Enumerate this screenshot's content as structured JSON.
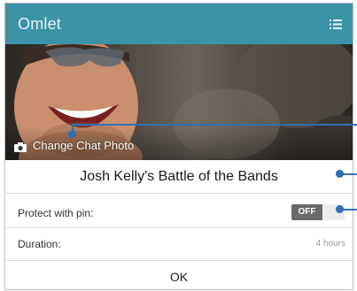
{
  "app": {
    "title": "Omlet"
  },
  "header": {
    "menu_icon": "list-menu-icon"
  },
  "photo": {
    "change_label": "Change Chat Photo",
    "camera_icon": "camera-icon"
  },
  "chat": {
    "title": "Josh Kelly's Battle of the Bands"
  },
  "settings": {
    "protect_label": "Protect with pin:",
    "protect_state": "OFF",
    "duration_label": "Duration:",
    "duration_value": "4 hours"
  },
  "actions": {
    "ok_label": "OK"
  },
  "colors": {
    "topbar": "#3b93a8",
    "callout": "#2f6fb3",
    "toggle_off": "#6a6a6a"
  }
}
